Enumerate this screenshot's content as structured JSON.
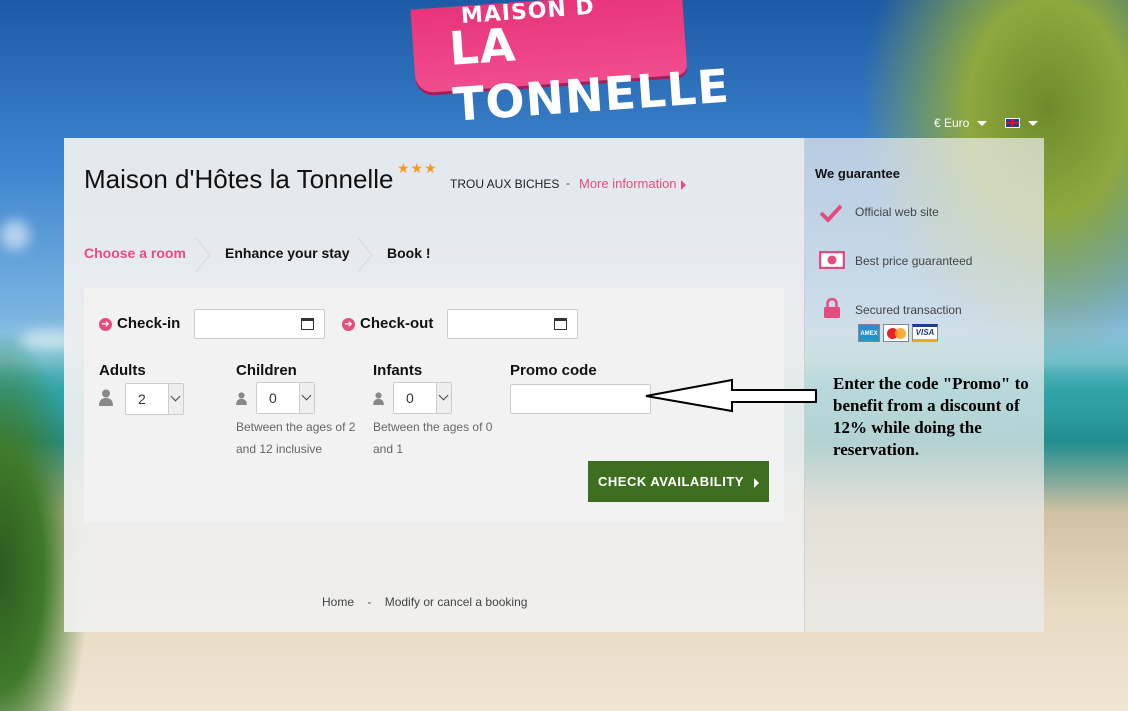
{
  "logo": {
    "line1": "MAISON D",
    "line2": "LA TONNELLE"
  },
  "topbar": {
    "currency": "€ Euro"
  },
  "hotel": {
    "name": "Maison d'Hôtes la Tonnelle",
    "stars": "★★★",
    "location": "TROU AUX BICHES",
    "separator": "-",
    "more_info": "More information"
  },
  "steps": [
    {
      "label": "Choose a room"
    },
    {
      "label": "Enhance your stay"
    },
    {
      "label": "Book !"
    }
  ],
  "form": {
    "checkin_label": "Check-in",
    "checkin_value": "",
    "checkout_label": "Check-out",
    "checkout_value": "",
    "adults_label": "Adults",
    "adults_value": "2",
    "children_label": "Children",
    "children_value": "0",
    "children_hint": "Between the ages of 2 and 12 inclusive",
    "infants_label": "Infants",
    "infants_value": "0",
    "infants_hint": "Between the ages of 0 and 1",
    "promo_label": "Promo code",
    "promo_value": "",
    "check_button": "CHECK AVAILABILITY"
  },
  "footer": {
    "home": "Home",
    "separator": "-",
    "modify": "Modify or cancel a booking"
  },
  "guarantee": {
    "title": "We guarantee",
    "items": [
      "Official web site",
      "Best price guaranteed",
      "Secured transaction"
    ],
    "cards": [
      "AMEX",
      "MC",
      "VISA"
    ]
  },
  "annotation": "Enter the code \"Promo\" to benefit from a discount of 12% while doing the reservation.",
  "colors": {
    "accent": "#e34d7e",
    "button": "#3e6f20",
    "stars": "#f29b1b"
  }
}
